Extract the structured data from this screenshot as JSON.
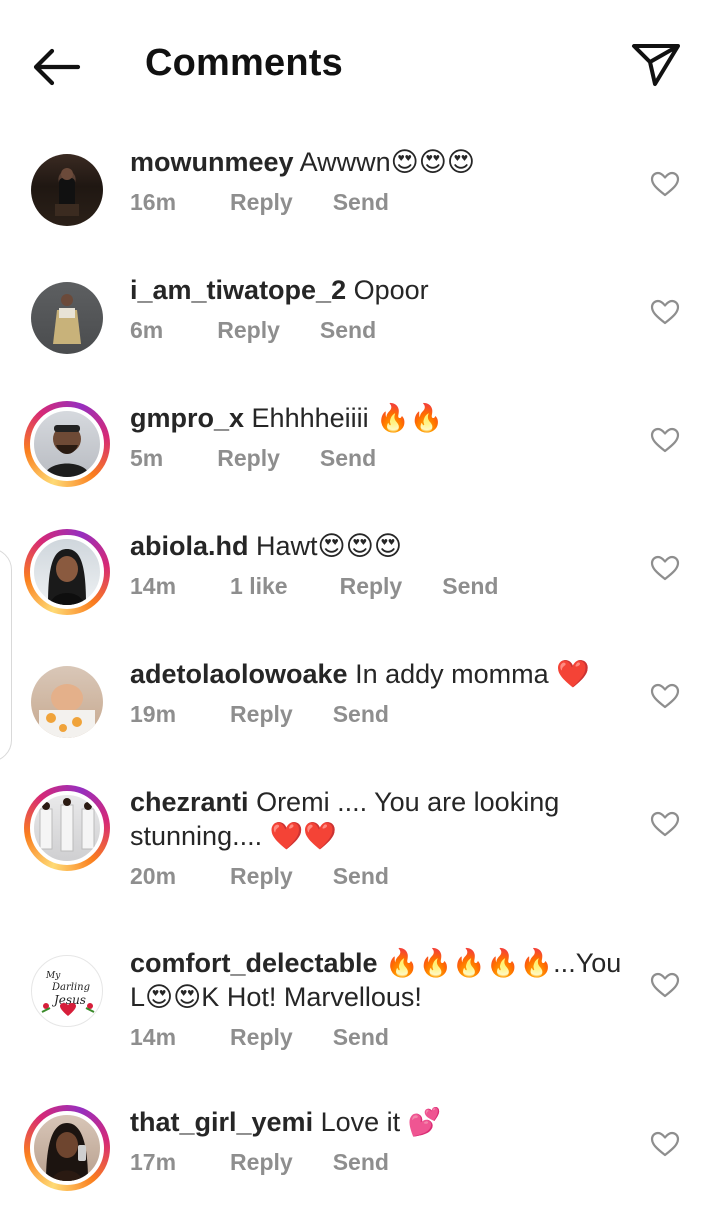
{
  "header": {
    "title": "Comments",
    "back_icon": "arrow-left-icon",
    "send_icon": "paper-plane-icon"
  },
  "colors": {
    "text": "#262626",
    "meta": "#8e8e8e",
    "story_ring": [
      "#feda75",
      "#fa7e1e",
      "#d62976",
      "#962fbf"
    ]
  },
  "comments": [
    {
      "username": "mowunmeey",
      "text": "Awwwn😍😍😍",
      "time": "16m",
      "likes": "",
      "reply": "Reply",
      "send": "Send",
      "story_ring": false
    },
    {
      "username": "i_am_tiwatope_2",
      "text": "Opoor",
      "time": "6m",
      "likes": "",
      "reply": "Reply",
      "send": "Send",
      "story_ring": false
    },
    {
      "username": "gmpro_x",
      "text": "Ehhhheiiii 🔥🔥",
      "time": "5m",
      "likes": "",
      "reply": "Reply",
      "send": "Send",
      "story_ring": true
    },
    {
      "username": "abiola.hd",
      "text": "Hawt😍😍😍",
      "time": "14m",
      "likes": "1 like",
      "reply": "Reply",
      "send": "Send",
      "story_ring": true
    },
    {
      "username": "adetolaolowoake",
      "text": "In addy momma ❤️",
      "time": "19m",
      "likes": "",
      "reply": "Reply",
      "send": "Send",
      "story_ring": false
    },
    {
      "username": "chezranti",
      "text": "Oremi .... You are looking stunning.... ❤️❤️",
      "time": "20m",
      "likes": "",
      "reply": "Reply",
      "send": "Send",
      "story_ring": true
    },
    {
      "username": "comfort_delectable",
      "text": "🔥🔥🔥🔥🔥...You L😍😍K Hot!  Marvellous!",
      "time": "14m",
      "likes": "",
      "reply": "Reply",
      "send": "Send",
      "story_ring": false
    },
    {
      "username": "that_girl_yemi",
      "text": "Love it 💕",
      "time": "17m",
      "likes": "",
      "reply": "Reply",
      "send": "Send",
      "story_ring": true
    }
  ]
}
